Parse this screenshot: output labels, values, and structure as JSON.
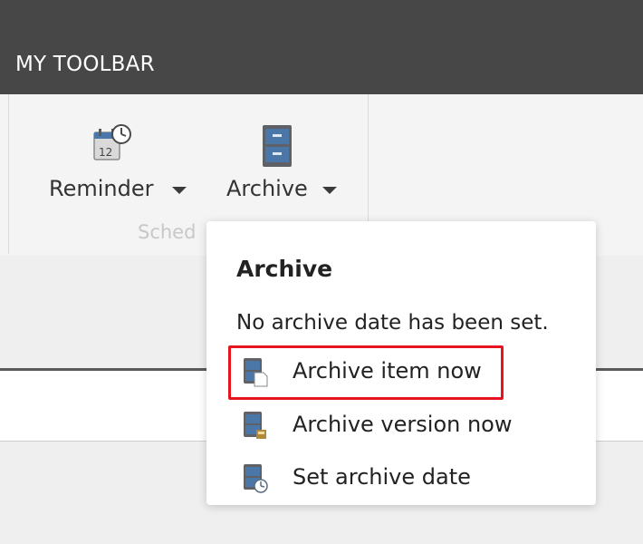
{
  "toolbar": {
    "title": "MY TOOLBAR",
    "group_label": "Sched",
    "reminder_label": "Reminder",
    "archive_label": "Archive"
  },
  "popup": {
    "heading": "Archive",
    "status": "No archive date has been set.",
    "items": [
      {
        "label": "Archive item now",
        "icon": "archive-item-icon"
      },
      {
        "label": "Archive version now",
        "icon": "archive-version-icon"
      },
      {
        "label": "Set archive date",
        "icon": "set-archive-date-icon"
      }
    ]
  },
  "colors": {
    "titlebar_bg": "#474747",
    "highlight": "#e6141e",
    "icon_blue": "#4a77a8"
  }
}
